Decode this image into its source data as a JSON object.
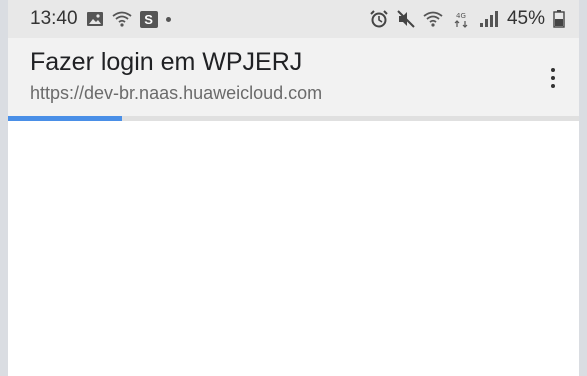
{
  "status_bar": {
    "time": "13:40",
    "battery_percent": "45%",
    "left_icons": [
      "image-icon",
      "wifi-icon",
      "s-app-icon",
      "dot-icon"
    ],
    "right_icons": [
      "alarm-icon",
      "mute-icon",
      "wifi-icon",
      "4g-icon",
      "signal-icon",
      "battery-icon"
    ],
    "s_badge": "S",
    "network_label": "4G"
  },
  "browser": {
    "title": "Fazer login em WPJERJ",
    "url": "https://dev-br.naas.huaweicloud.com",
    "load_progress": 0.2,
    "accent_color": "#4a8fe7"
  }
}
